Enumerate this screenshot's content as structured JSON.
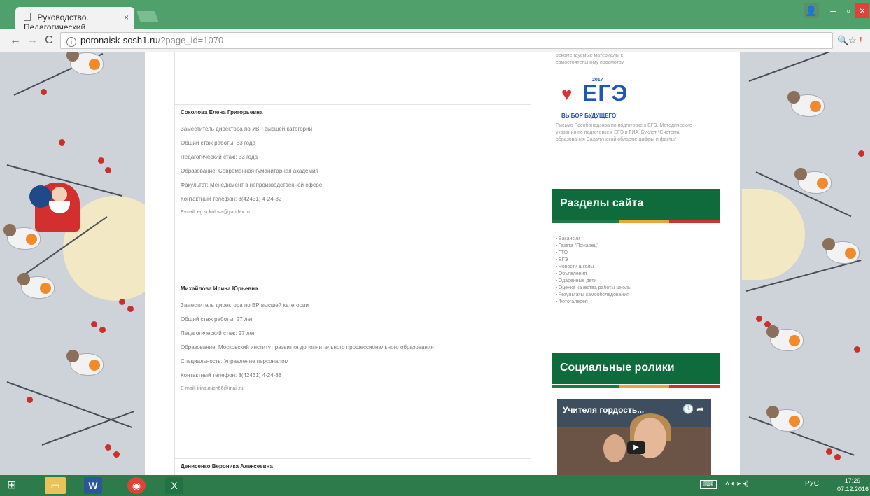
{
  "browser": {
    "tab_title": "Руководство. Педагогический...",
    "tab_close": "×",
    "url_domain": "poronaisk-sosh1.ru",
    "url_path": "/?page_id=1070",
    "back": "←",
    "forward": "→",
    "reload": "C",
    "zoom_icon": "🔍",
    "star_icon": "☆",
    "ext_icon": "!",
    "window_user": "👤",
    "window_min": "–",
    "window_max": "▫",
    "window_close": "×"
  },
  "staff": [
    {
      "name": "Соколова Елена Григорьевна",
      "lines": [
        "Заместитель директора по УВР высшей категории",
        "Общий стаж работы: 33 года",
        "Педагогический стаж: 33 года",
        "Образование: Современная гуманитарная академия",
        "Факультет: Менеджмент в непроизводственной сфере",
        "Контактный телефон: 8(42431) 4-24-82",
        "E-mail: eg.sokolova@yandex.ru"
      ]
    },
    {
      "name": "Михайлова Ирина Юрьевна",
      "lines": [
        "Заместитель директора по ВР высшей категории",
        "Общий стаж работы: 27 лет",
        "Педагогический стаж: 27 лет",
        "Образование: Московский институт развития дополнительного профессионального образования",
        "Специальность: Управление персоналом",
        "Контактный телефон: 8(42431) 4-24-88",
        "E-mail: irina.mich66@mail.ru"
      ]
    },
    {
      "name": "Денисенко Вероника Алексеевна",
      "lines": []
    }
  ],
  "sidebar": {
    "top_text": "рекомендуемые материалы к самостоятельному просмотру",
    "ege_year": "2017",
    "ege_logo": "ЕГЭ",
    "ege_tagline": "ВЫБОР БУДУЩЕГО!",
    "ege_links": "Письмо Рособрнадзора по подготовке к ЕГЭ. Методические указания по подготовке к ЕГЭ и ГИА. Буклет \"Система образования Сахалинской области: цифры и факты\"",
    "sections_title": "Разделы сайта",
    "sections": [
      "Вакансии",
      "Газета \"Пожарец\"",
      "ГТО",
      "ЕГЭ",
      "Новости школы",
      "Объявления",
      "Одаренные дети",
      "Оценка качества работы школы",
      "Результаты самообследования",
      "Фотогалерея"
    ],
    "social_title": "Социальные ролики",
    "video_title": "Учителя гордость...",
    "video_play": "▶",
    "video_icons": "🕓 ➦"
  },
  "taskbar": {
    "start_icon": "⊞",
    "explorer_icon": "▭",
    "word_icon": "W",
    "chrome_icon": "◉",
    "excel_icon": "X",
    "keyboard": "⌨",
    "tray_icons": "˄ ◐ ▸ ◂)",
    "lang": "РУС",
    "time": "17:29",
    "date": "07.12.2016"
  }
}
